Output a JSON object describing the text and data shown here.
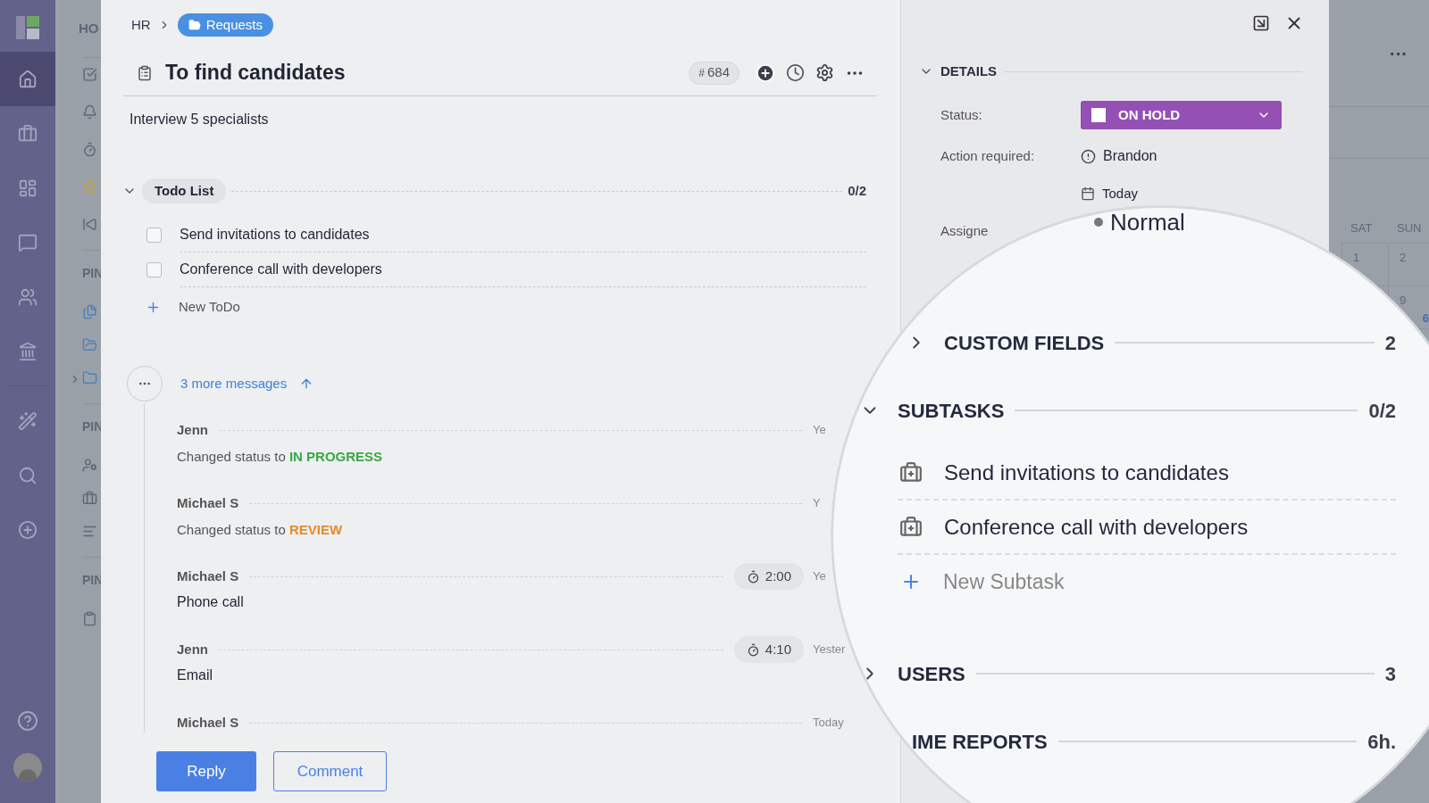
{
  "nav_rail": {
    "items": [
      {
        "selected": true
      },
      {
        "selected": false
      },
      {
        "selected": false
      },
      {
        "selected": false
      },
      {
        "selected": false
      },
      {
        "selected": false
      },
      {
        "selected": false
      },
      {
        "selected": false
      },
      {
        "selected": false
      }
    ]
  },
  "side_panel": {
    "heading": "HO",
    "sections": [
      {
        "title": "PIN"
      },
      {
        "title": "PIN"
      },
      {
        "title": "PIN"
      }
    ]
  },
  "breadcrumb": {
    "parent": "HR",
    "folder": "Requests"
  },
  "task": {
    "title": "To find candidates",
    "badge_symbol": "#",
    "badge_value": "684",
    "description": "Interview 5 specialists"
  },
  "todo": {
    "title": "Todo List",
    "expanded": true,
    "count": "0/2",
    "add_label": "New ToDo",
    "items": [
      {
        "label": "Send invitations to candidates",
        "checked": false
      },
      {
        "label": "Conference call with developers",
        "checked": false
      }
    ]
  },
  "thread": {
    "more": "3 more messages",
    "messages": [
      {
        "author": "Jenn",
        "time": "Ye",
        "kind": "status",
        "text": "Changed status to",
        "status": "IN PROGRESS",
        "color": "#3aa845"
      },
      {
        "author": "Michael S",
        "time": "Y",
        "kind": "status",
        "text": "Changed status to",
        "status": "REVIEW",
        "color": "#e8892b"
      },
      {
        "author": "Michael S",
        "time": "Ye",
        "kind": "comment",
        "duration": "2:00",
        "text": "Phone call"
      },
      {
        "author": "Jenn",
        "time": "Yester",
        "kind": "comment",
        "duration": "4:10",
        "text": "Email"
      },
      {
        "author": "Michael S",
        "time": "Today",
        "kind": "header"
      }
    ]
  },
  "actions": [
    {
      "label": "Reply",
      "kind": "primary"
    },
    {
      "label": "Comment",
      "kind": "secondary"
    }
  ],
  "details": {
    "title": "DETAILS",
    "expanded": true,
    "fields": [
      {
        "label": "Status:",
        "kind": "status",
        "value": "ON HOLD",
        "color": "#9450b5"
      },
      {
        "label": "Action required:",
        "kind": "person",
        "value": "Brandon"
      },
      {
        "kind": "date",
        "value": "Today"
      },
      {
        "label": "Assigne",
        "kind": "label"
      }
    ]
  },
  "background_calendar": {
    "menu": "···",
    "days": [
      "SAT",
      "SUN"
    ],
    "dates": [
      {
        "label": "1",
        "today": false
      },
      {
        "label": "2",
        "today": false
      },
      {
        "label": "9",
        "today": false
      },
      {
        "label": "6",
        "today": true
      }
    ]
  },
  "magnifier": {
    "priority": "Normal",
    "sections": [
      {
        "title": "CUSTOM FIELDS",
        "expanded": false,
        "count": "2"
      },
      {
        "title": "SUBTASKS",
        "expanded": true,
        "count": "0/2",
        "add_label": "New Subtask",
        "items": [
          "Send invitations to candidates",
          "Conference call with developers"
        ]
      },
      {
        "title": "USERS",
        "expanded": false,
        "count": "3"
      },
      {
        "title": "IME REPORTS",
        "count": "6h."
      }
    ]
  }
}
